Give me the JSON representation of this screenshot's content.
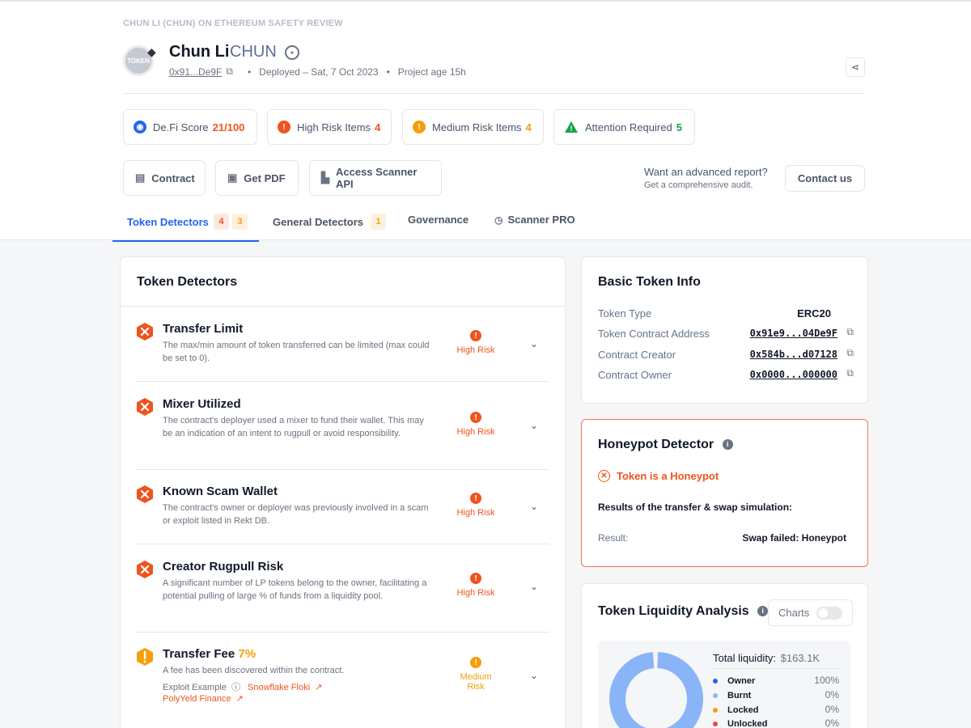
{
  "header": {
    "breadcrumb": "CHUN LI (CHUN) ON ETHEREUM SAFETY REVIEW",
    "logo_text": "TOKEN",
    "token_name": "Chun Li",
    "token_symbol": "CHUN",
    "address_short": "0x91...De9F",
    "deployed": "Deployed – Sat, 7 Oct 2023",
    "project_age": "Project age 15h"
  },
  "metrics": {
    "defi_score_label": "De.Fi Score",
    "defi_score_value": "21/100",
    "high_risk_label": "High Risk Items",
    "high_risk_value": "4",
    "medium_risk_label": "Medium Risk Items",
    "medium_risk_value": "4",
    "attention_label": "Attention Required",
    "attention_value": "5"
  },
  "actions": {
    "contract": "Contract",
    "get_pdf": "Get PDF",
    "scanner_api": "Access Scanner API",
    "adv_title": "Want an advanced report?",
    "adv_sub": "Get a comprehensive audit.",
    "contact": "Contact us"
  },
  "tabs": [
    {
      "label": "Token Detectors",
      "badge1": "4",
      "badge2": "3"
    },
    {
      "label": "General Detectors",
      "badge1": "1"
    },
    {
      "label": "Governance"
    },
    {
      "label": "Scanner PRO"
    }
  ],
  "detectors": {
    "title": "Token Detectors",
    "items": [
      {
        "name": "Transfer Limit",
        "desc": "The max/min amount of token transferred can be limited (max could be set to 0).",
        "risk": "High Risk"
      },
      {
        "name": "Mixer Utilized",
        "desc": "The contract's deployer used a mixer to fund their wallet. This may be an indication of an intent to rugpull or avoid responsibility.",
        "risk": "High Risk"
      },
      {
        "name": "Known Scam Wallet",
        "desc": "The contract's owner or deployer was previously involved in a scam or exploit listed in Rekt DB.",
        "risk": "High Risk"
      },
      {
        "name": "Creator Rugpull Risk",
        "desc": "A significant number of LP tokens belong to the owner, facilitating a potential pulling of large % of funds from a liquidity pool.",
        "risk": "High Risk"
      },
      {
        "name": "Transfer Fee",
        "fee": "7%",
        "desc": "A fee has been discovered within the contract.",
        "risk": "Medium Risk",
        "exploit_label": "Exploit Example",
        "exploit_link1": "Snowflake Floki",
        "exploit_link2": "PolyYeld Finance"
      }
    ]
  },
  "basic_info": {
    "title": "Basic Token Info",
    "rows": [
      {
        "label": "Token Type",
        "value": "ERC20"
      },
      {
        "label": "Token Contract Address",
        "value": "0x91e9...04De9F"
      },
      {
        "label": "Contract Creator",
        "value": "0x584b...d07128"
      },
      {
        "label": "Contract Owner",
        "value": "0x0000...000000"
      }
    ]
  },
  "honeypot": {
    "title": "Honeypot Detector",
    "status": "Token is a Honeypot",
    "sim_label": "Results of the transfer & swap simulation:",
    "result_label": "Result:",
    "result_value": "Swap failed: Honeypot"
  },
  "liquidity": {
    "title": "Token Liquidity Analysis",
    "charts_label": "Charts",
    "total_label": "Total liquidity:",
    "total_value": "$163.1K",
    "legend": [
      {
        "label": "Owner",
        "pct": "100%",
        "color": "#2563eb"
      },
      {
        "label": "Burnt",
        "pct": "0%",
        "color": "#8ab4f8"
      },
      {
        "label": "Locked",
        "pct": "0%",
        "color": "#f59e0b"
      },
      {
        "label": "Unlocked",
        "pct": "0%",
        "color": "#ef4444"
      }
    ]
  },
  "colors": {
    "high_risk": "#f0541e",
    "medium_risk": "#f59e0b",
    "attention": "#16a34a",
    "primary": "#2563eb"
  }
}
